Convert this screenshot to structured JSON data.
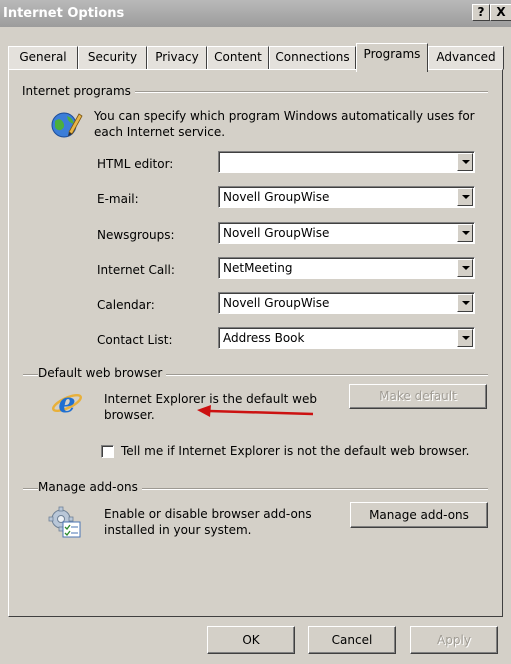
{
  "window": {
    "title": "Internet Options",
    "help_glyph": "?",
    "close_glyph": "X"
  },
  "tabs": [
    {
      "label": "General"
    },
    {
      "label": "Security"
    },
    {
      "label": "Privacy"
    },
    {
      "label": "Content"
    },
    {
      "label": "Connections"
    },
    {
      "label": "Programs",
      "active": true
    },
    {
      "label": "Advanced"
    }
  ],
  "internet_programs": {
    "title": "Internet programs",
    "description_line1": "You can specify which program Windows automatically uses for",
    "description_line2": "each Internet service.",
    "icon": "globe-pencil-icon",
    "rows": [
      {
        "label": "HTML editor:",
        "value": ""
      },
      {
        "label": "E-mail:",
        "value": "Novell GroupWise"
      },
      {
        "label": "Newsgroups:",
        "value": "Novell GroupWise"
      },
      {
        "label": "Internet Call:",
        "value": "NetMeeting"
      },
      {
        "label": "Calendar:",
        "value": "Novell GroupWise"
      },
      {
        "label": "Contact List:",
        "value": "Address Book"
      }
    ]
  },
  "default_browser": {
    "title": "Default web browser",
    "icon": "internet-explorer-icon",
    "status_line1": "Internet Explorer is the default web",
    "status_line2": "browser.",
    "make_default_label": "Make default",
    "check_label": "Tell me if Internet Explorer is not the default web browser.",
    "checked": false,
    "annotation_color": "#cc1111"
  },
  "addons": {
    "title": "Manage add-ons",
    "icon": "gear-list-icon",
    "description_line1": "Enable or disable browser add-ons",
    "description_line2": "installed in your system.",
    "button_label": "Manage add-ons"
  },
  "footer": {
    "ok_label": "OK",
    "cancel_label": "Cancel",
    "apply_label": "Apply"
  }
}
